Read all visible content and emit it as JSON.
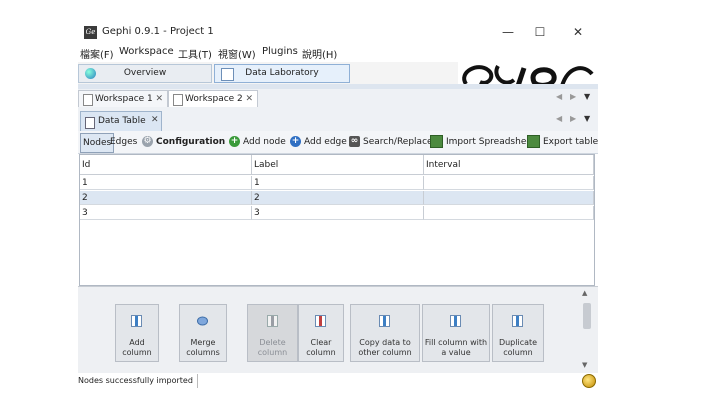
{
  "app": {
    "title": "Gephi 0.9.1 - Project 1",
    "logo_text": "Ge"
  },
  "window_controls": {
    "minimize": "—",
    "maximize": "☐",
    "close": "✕"
  },
  "menu": [
    "檔案(F)",
    "Workspace",
    "工具(T)",
    "視窗(W)",
    "Plugins",
    "說明(H)"
  ],
  "workspace_tabs": [
    {
      "label": "Overview",
      "icon": "globe-icon",
      "selected": false
    },
    {
      "label": "Data Laboratory",
      "icon": "table-icon",
      "selected": true
    }
  ],
  "workspaces": [
    {
      "label": "Workspace 1",
      "close": "✕"
    },
    {
      "label": "Workspace 2",
      "close": "✕"
    }
  ],
  "nav_arrows": {
    "left": "◀",
    "right": "▶",
    "menu": "▼"
  },
  "data_table_tab": {
    "label": "Data Table",
    "close": "✕"
  },
  "toolbar": {
    "nodes": "Nodes",
    "edges": "Edges",
    "configuration": "Configuration",
    "add_node": "Add node",
    "add_edge": "Add edge",
    "search_replace": "Search/Replace",
    "import_spreadsheet": "Import Spreadsheet",
    "export_table": "Export table"
  },
  "table": {
    "headers": [
      "Id",
      "Label",
      "Interval"
    ],
    "rows": [
      [
        "1",
        "1",
        ""
      ],
      [
        "2",
        "2",
        ""
      ],
      [
        "3",
        "3",
        ""
      ]
    ],
    "selected_row": 1
  },
  "actions": [
    {
      "label": "Add column",
      "icon": "add-column-icon",
      "disabled": false
    },
    {
      "label": "Merge columns",
      "icon": "merge-columns-icon",
      "disabled": false
    },
    {
      "label": "Delete column",
      "icon": "delete-column-icon",
      "disabled": true
    },
    {
      "label": "Clear column",
      "icon": "clear-column-icon",
      "disabled": false
    },
    {
      "label": "Copy data to other column",
      "icon": "copy-data-icon",
      "disabled": false
    },
    {
      "label": "Fill column with a value",
      "icon": "fill-column-icon",
      "disabled": false
    },
    {
      "label": "Duplicate column",
      "icon": "duplicate-column-icon",
      "disabled": false
    }
  ],
  "status": {
    "text": "Nodes successfully imported"
  },
  "colors": {
    "selected_row": "#dce6f2",
    "accent": "#2b6cb0",
    "add_green": "#3a9a3a",
    "add_blue": "#2f6fc3"
  }
}
